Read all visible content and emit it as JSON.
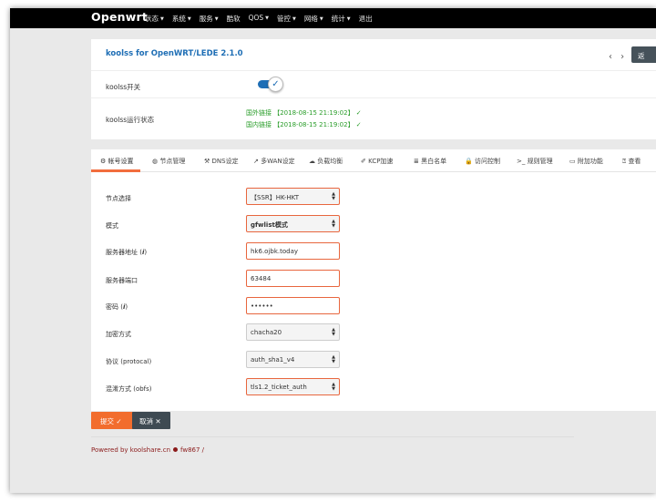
{
  "app": {
    "brand": "Openwrt"
  },
  "nav": {
    "items": [
      {
        "label": "状态",
        "caret": "▼"
      },
      {
        "label": "系统",
        "caret": "▼"
      },
      {
        "label": "服务",
        "caret": "▼"
      },
      {
        "label": "酷软",
        "caret": ""
      },
      {
        "label": "QOS",
        "caret": "▼"
      },
      {
        "label": "管控",
        "caret": "▼"
      },
      {
        "label": "网络",
        "caret": "▼"
      },
      {
        "label": "统计",
        "caret": "▼"
      },
      {
        "label": "退出",
        "caret": ""
      }
    ]
  },
  "header": {
    "title": "koolss for OpenWRT/LEDE 2.1.0",
    "pager": "‹ ›",
    "back_label": "返",
    "switch_label": "koolss开关",
    "switch_state": "on",
    "status_label": "koolss运行状态",
    "status_foreign": "国外链接 【2018-08-15 21:19:02】 ✓",
    "status_domestic": "国内链接 【2018-08-15 21:19:02】 ✓"
  },
  "tabs": [
    {
      "icon": "⚙",
      "label": "帐号设置",
      "active": true
    },
    {
      "icon": "◍",
      "label": "节点管理"
    },
    {
      "icon": "⚒",
      "label": "DNS设定"
    },
    {
      "icon": "↗",
      "label": "多WAN设定"
    },
    {
      "icon": "☁",
      "label": "负载均衡"
    },
    {
      "icon": "✐",
      "label": "KCP加速"
    },
    {
      "icon": "≣",
      "label": "黑白名单"
    },
    {
      "icon": "🔒",
      "label": "访问控制"
    },
    {
      "icon": ">_",
      "label": "规则管理"
    },
    {
      "icon": "▭",
      "label": "附加功能"
    },
    {
      "icon": "⍰",
      "label": "查看"
    }
  ],
  "form": {
    "node_label": "节点选择",
    "node_value": "【SSR】HK-HKT",
    "mode_label": "模式",
    "mode_value": "gfwlist模式",
    "server_label": "服务器地址",
    "server_value": "hk6.ojbk.today",
    "port_label": "服务器端口",
    "port_value": "63484",
    "password_label": "密码",
    "password_value": "••••••",
    "info_glyph": "i",
    "encrypt_label": "加密方式",
    "encrypt_value": "chacha20",
    "protocol_label": "协议 (protocal)",
    "protocol_value": "auth_sha1_v4",
    "obfs_label": "混淆方式 (obfs)",
    "obfs_value": "tls1.2_ticket_auth"
  },
  "actions": {
    "submit_label": "提交 ✓",
    "cancel_label": "取消 ✕"
  },
  "footer": {
    "powered": "Powered by koolshare.cn",
    "author": "fw867 /"
  },
  "colors": {
    "accent": "#f26d2d",
    "brand_blue": "#1e6eb5",
    "status_green": "#2a9d2a",
    "navbar": "#000000"
  }
}
